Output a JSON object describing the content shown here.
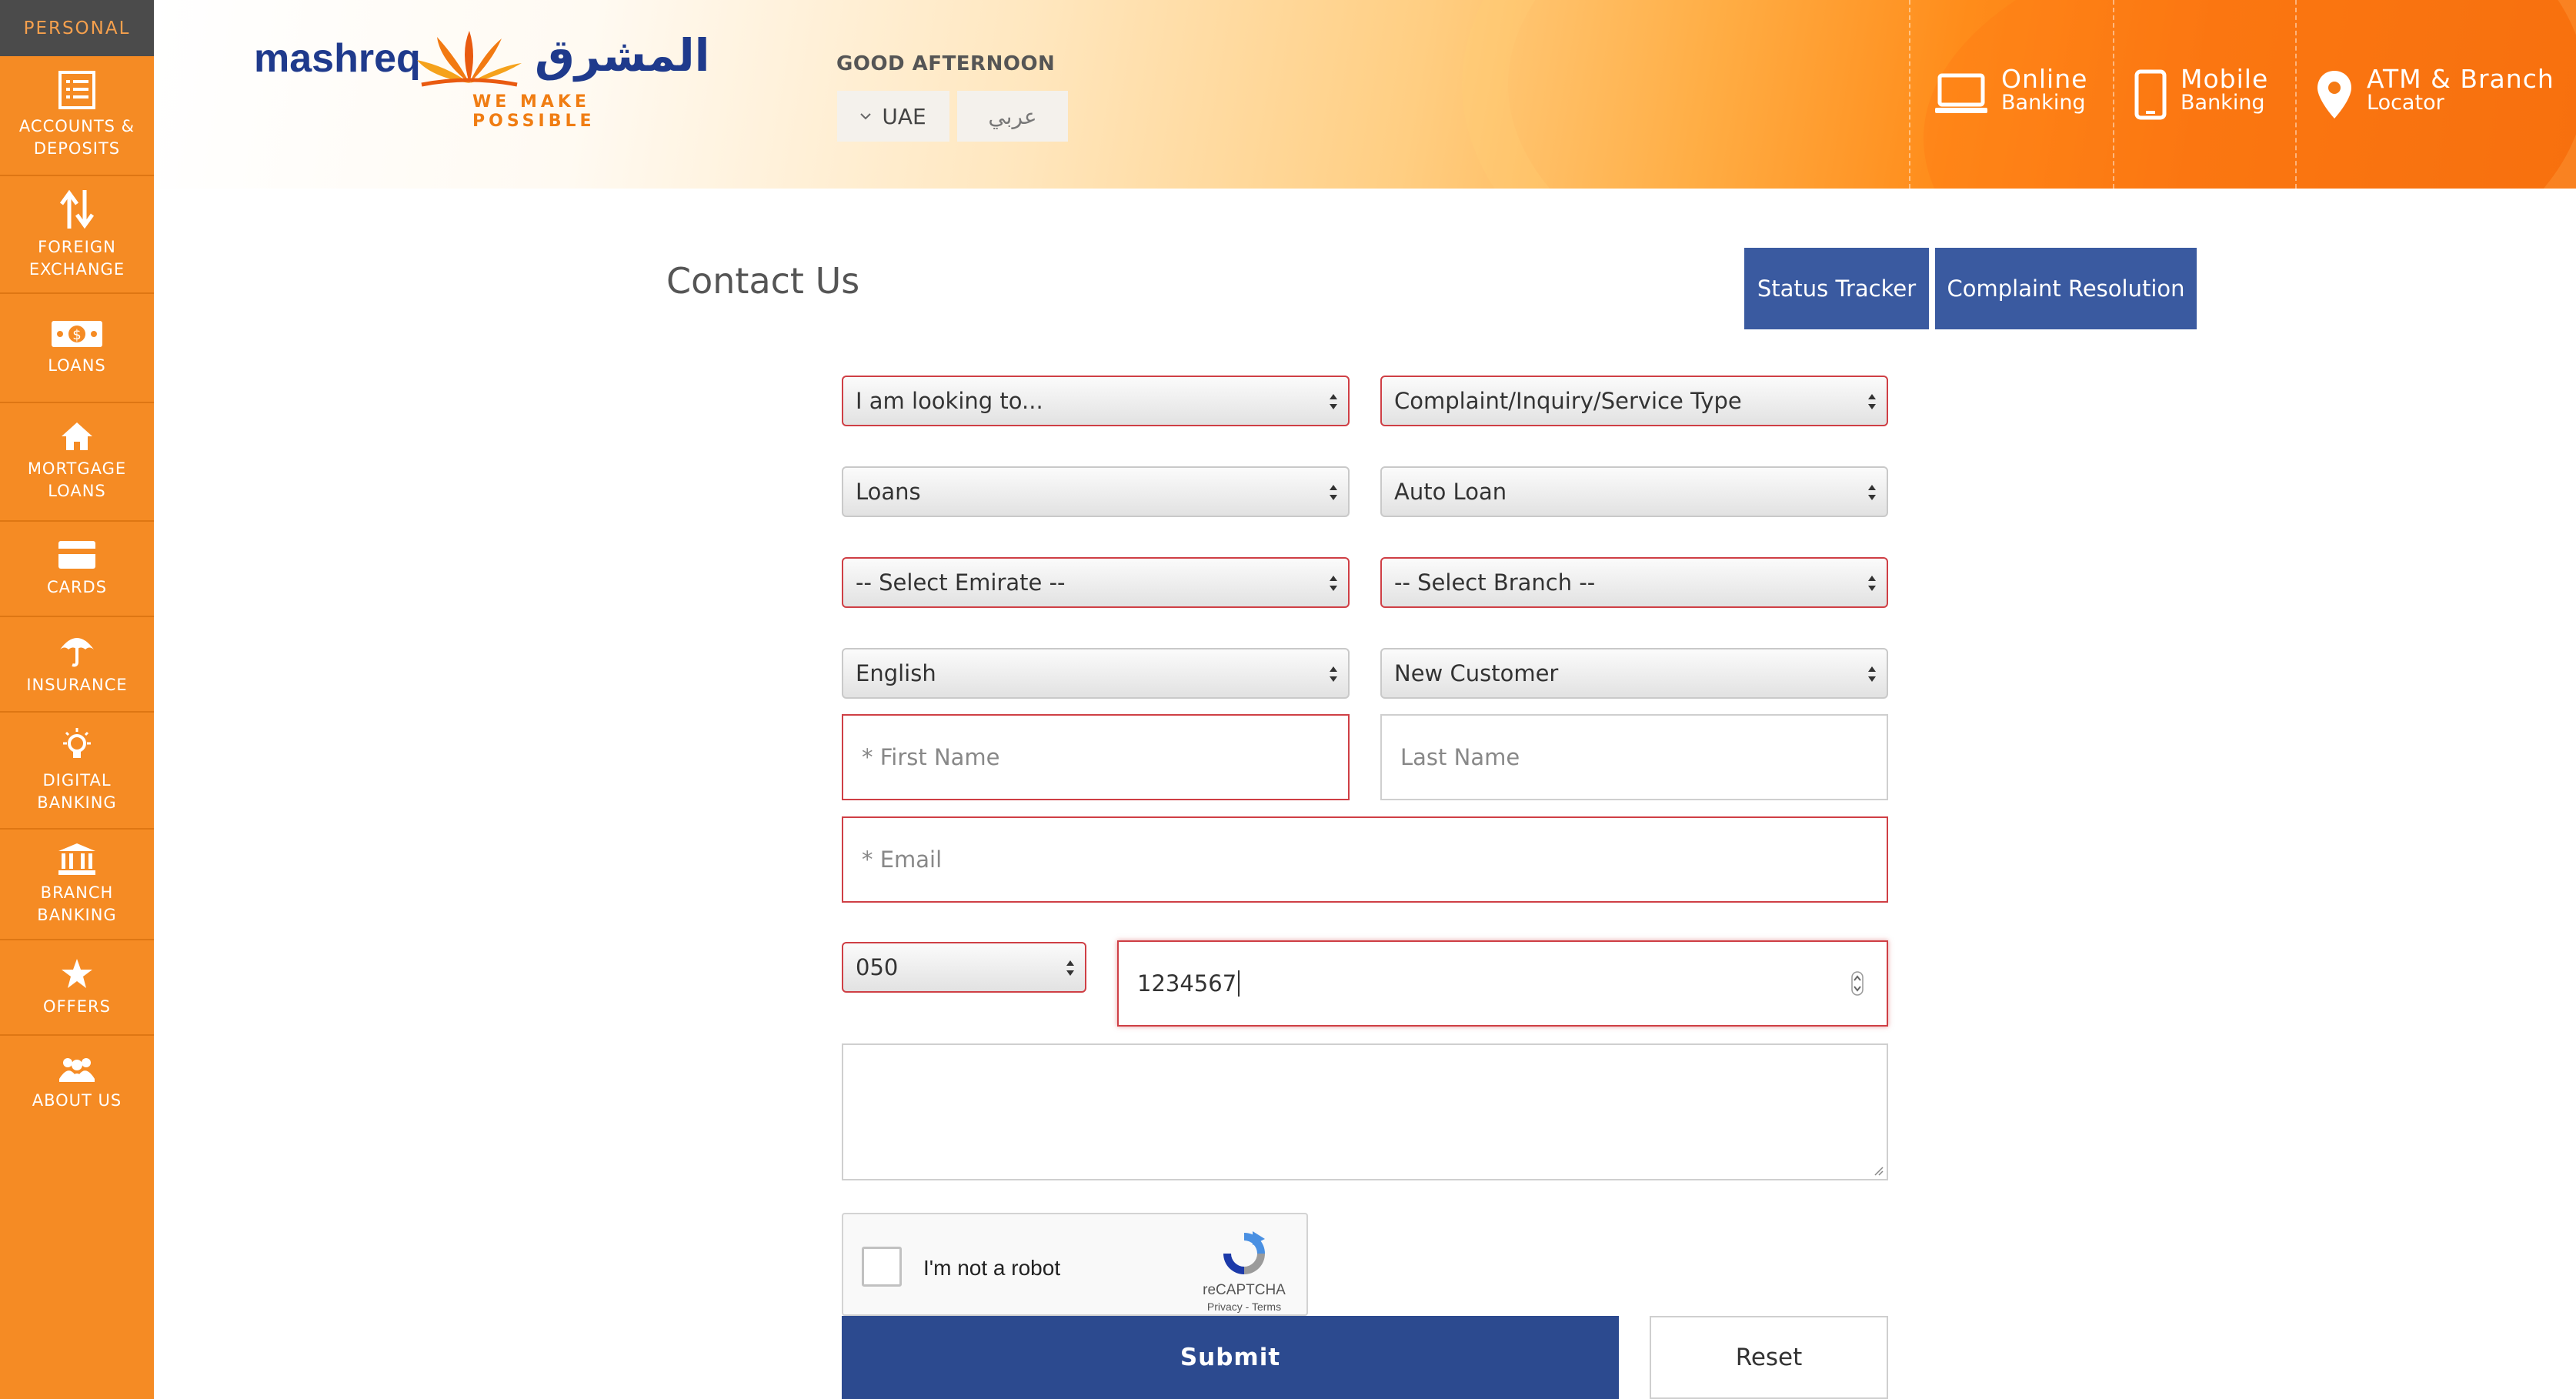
{
  "sidebar": {
    "persona": "PERSONAL",
    "items": [
      {
        "label1": "ACCOUNTS &",
        "label2": "DEPOSITS",
        "icon": "list-icon"
      },
      {
        "label1": "FOREIGN",
        "label2": "EXCHANGE",
        "icon": "exchange-arrows-icon"
      },
      {
        "label1": "LOANS",
        "label2": "",
        "icon": "money-bill-icon"
      },
      {
        "label1": "MORTGAGE",
        "label2": "LOANS",
        "icon": "home-icon"
      },
      {
        "label1": "CARDS",
        "label2": "",
        "icon": "credit-card-icon"
      },
      {
        "label1": "INSURANCE",
        "label2": "",
        "icon": "umbrella-icon"
      },
      {
        "label1": "DIGITAL",
        "label2": "BANKING",
        "icon": "lightbulb-icon"
      },
      {
        "label1": "BRANCH",
        "label2": "BANKING",
        "icon": "bank-building-icon"
      },
      {
        "label1": "OFFERS",
        "label2": "",
        "icon": "star-icon"
      },
      {
        "label1": "ABOUT US",
        "label2": "",
        "icon": "people-icon"
      }
    ]
  },
  "header": {
    "logo_word": "mashreq",
    "logo_arabic": "المشرق",
    "logo_tagline": "WE MAKE POSSIBLE",
    "greeting": "GOOD AFTERNOON",
    "country": "UAE",
    "language_toggle": "عربي",
    "quick_links": [
      {
        "line1": "Online",
        "line2": "Banking",
        "icon": "laptop-icon"
      },
      {
        "line1": "Mobile",
        "line2": "Banking",
        "icon": "mobile-phone-icon"
      },
      {
        "line1": "ATM & Branch",
        "line2": "Locator",
        "icon": "map-pin-icon"
      }
    ]
  },
  "main": {
    "title": "Contact Us",
    "status_tracker": "Status Tracker",
    "complaint_resolution": "Complaint Resolution",
    "form": {
      "looking_to": "I am looking to...",
      "service_type": "Complaint/Inquiry/Service Type",
      "product": "Loans",
      "sub_product": "Auto Loan",
      "emirate": "-- Select Emirate --",
      "branch": "-- Select Branch --",
      "language": "English",
      "customer_type": "New Customer",
      "first_name_placeholder": "* First Name",
      "last_name_placeholder": "Last Name",
      "email_placeholder": "* Email",
      "phone_prefix": "050",
      "phone_number": "1234567",
      "message": "",
      "recaptcha_label": "I'm not a robot",
      "recaptcha_brand": "reCAPTCHA",
      "recaptcha_links": "Privacy - Terms",
      "submit": "Submit",
      "reset": "Reset"
    }
  }
}
